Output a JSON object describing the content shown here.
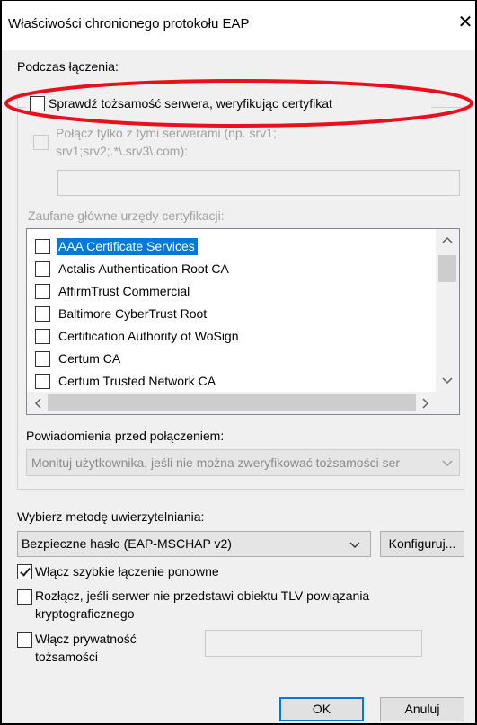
{
  "window": {
    "title": "Właściwości chronionego protokołu EAP",
    "close_glyph": "✕"
  },
  "connect_section": {
    "label": "Podczas łączenia:",
    "verify_cert": {
      "label": "Sprawdź tożsamość serwera, weryfikując certyfikat",
      "checked": false
    },
    "connect_servers": {
      "label_line1": "Połącz tylko z tymi serwerami (np. srv1;",
      "label_line2": "srv1;srv2;.*\\.srv3\\.com):",
      "checked": false,
      "enabled": false
    },
    "servers_value": "",
    "trusted_roots_label": "Zaufane główne urzędy certyfikacji:",
    "certificates": [
      {
        "name": "AAA Certificate Services",
        "checked": false,
        "selected": true
      },
      {
        "name": "Actalis Authentication Root CA",
        "checked": false,
        "selected": false
      },
      {
        "name": "AffirmTrust Commercial",
        "checked": false,
        "selected": false
      },
      {
        "name": "Baltimore CyberTrust Root",
        "checked": false,
        "selected": false
      },
      {
        "name": "Certification Authority of WoSign",
        "checked": false,
        "selected": false
      },
      {
        "name": "Certum CA",
        "checked": false,
        "selected": false
      },
      {
        "name": "Certum Trusted Network CA",
        "checked": false,
        "selected": false
      }
    ],
    "notifications_label": "Powiadomienia przed połączeniem:",
    "notifications_value": "Monituj użytkownika, jeśli nie można zweryfikować tożsamości ser"
  },
  "auth": {
    "label": "Wybierz metodę uwierzytelniania:",
    "method_value": "Bezpieczne hasło (EAP-MSCHAP v2)",
    "configure_label": "Konfiguruj...",
    "fast_reconnect": {
      "label": "Włącz szybkie łączenie ponowne",
      "checked": true
    },
    "disconnect_tlv": {
      "label_line1": "Rozłącz, jeśli serwer nie przedstawi obiektu TLV powiązania",
      "label_line2": "kryptograficznego",
      "checked": false
    },
    "identity_privacy": {
      "label_line1": "Włącz prywatność",
      "label_line2": "tożsamości",
      "checked": false
    },
    "identity_value": ""
  },
  "buttons": {
    "ok": "OK",
    "cancel": "Anuluj"
  },
  "colors": {
    "highlight_ellipse": "#e8101e",
    "selection": "#0078d7"
  }
}
